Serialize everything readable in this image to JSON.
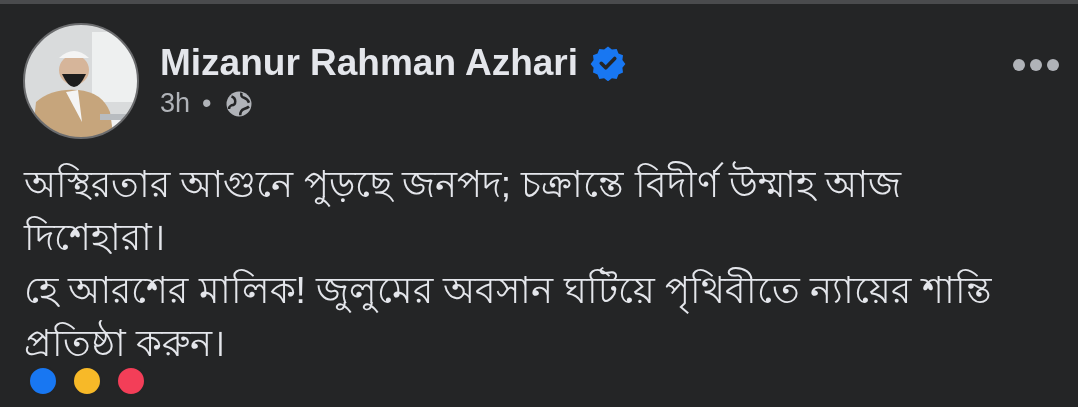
{
  "post": {
    "author": "Mizanur Rahman Azhari",
    "verified": true,
    "time": "3h",
    "separator": "•",
    "paragraphs": [
      "অস্থিরতার আগুনে পুড়ছে জনপদ; চক্রান্তে বিদীর্ণ উম্মাহ আজ দিশেহারা।",
      "হে আরশের মালিক! জুলুমের অবসান ঘটিয়ে পৃথিবীতে ন্যায়ের শান্তি প্রতিষ্ঠা করুন।"
    ],
    "reactions": [
      {
        "color": "#1877f2"
      },
      {
        "color": "#f7b928"
      },
      {
        "color": "#f33e58"
      }
    ]
  }
}
